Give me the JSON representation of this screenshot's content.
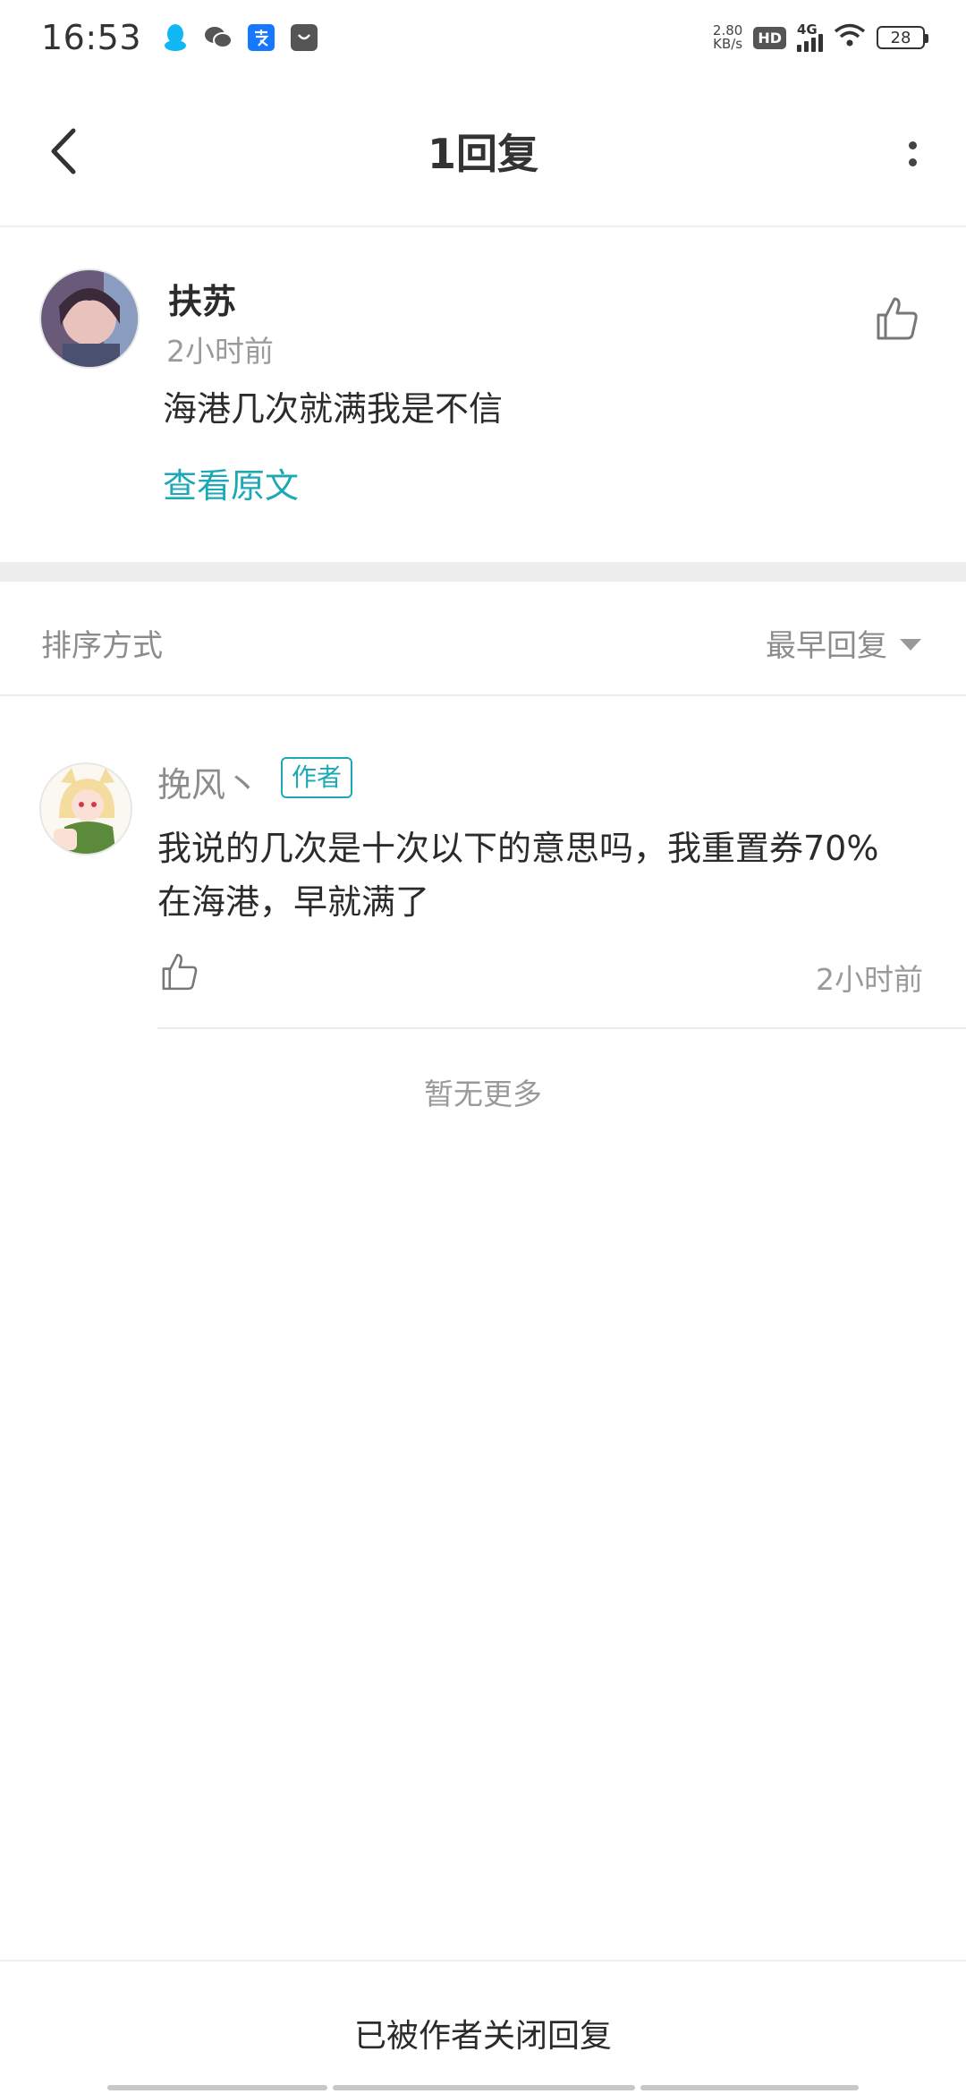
{
  "status_bar": {
    "time": "16:53",
    "net_speed_value": "2.80",
    "net_speed_unit": "KB/s",
    "hd": "HD",
    "network": "4G",
    "battery": "28",
    "app_icons": [
      "qq-icon",
      "wechat-icon",
      "alipay-icon",
      "store-icon"
    ]
  },
  "header": {
    "title": "1回复"
  },
  "original_comment": {
    "user_name": "扶苏",
    "time": "2小时前",
    "text": "海港几次就满我是不信",
    "view_original": "查看原文"
  },
  "sort": {
    "label": "排序方式",
    "value": "最早回复"
  },
  "replies": [
    {
      "user_name": "挽风丶",
      "tag": "作者",
      "text": "我说的几次是十次以下的意思吗，我重置券70%在海港，早就满了",
      "time": "2小时前"
    }
  ],
  "no_more": "暂无更多",
  "footer": {
    "closed_message": "已被作者关闭回复"
  },
  "colors": {
    "accent": "#1aa9b5",
    "text_primary": "#2b2b2b",
    "text_secondary": "#9a9a9a"
  }
}
